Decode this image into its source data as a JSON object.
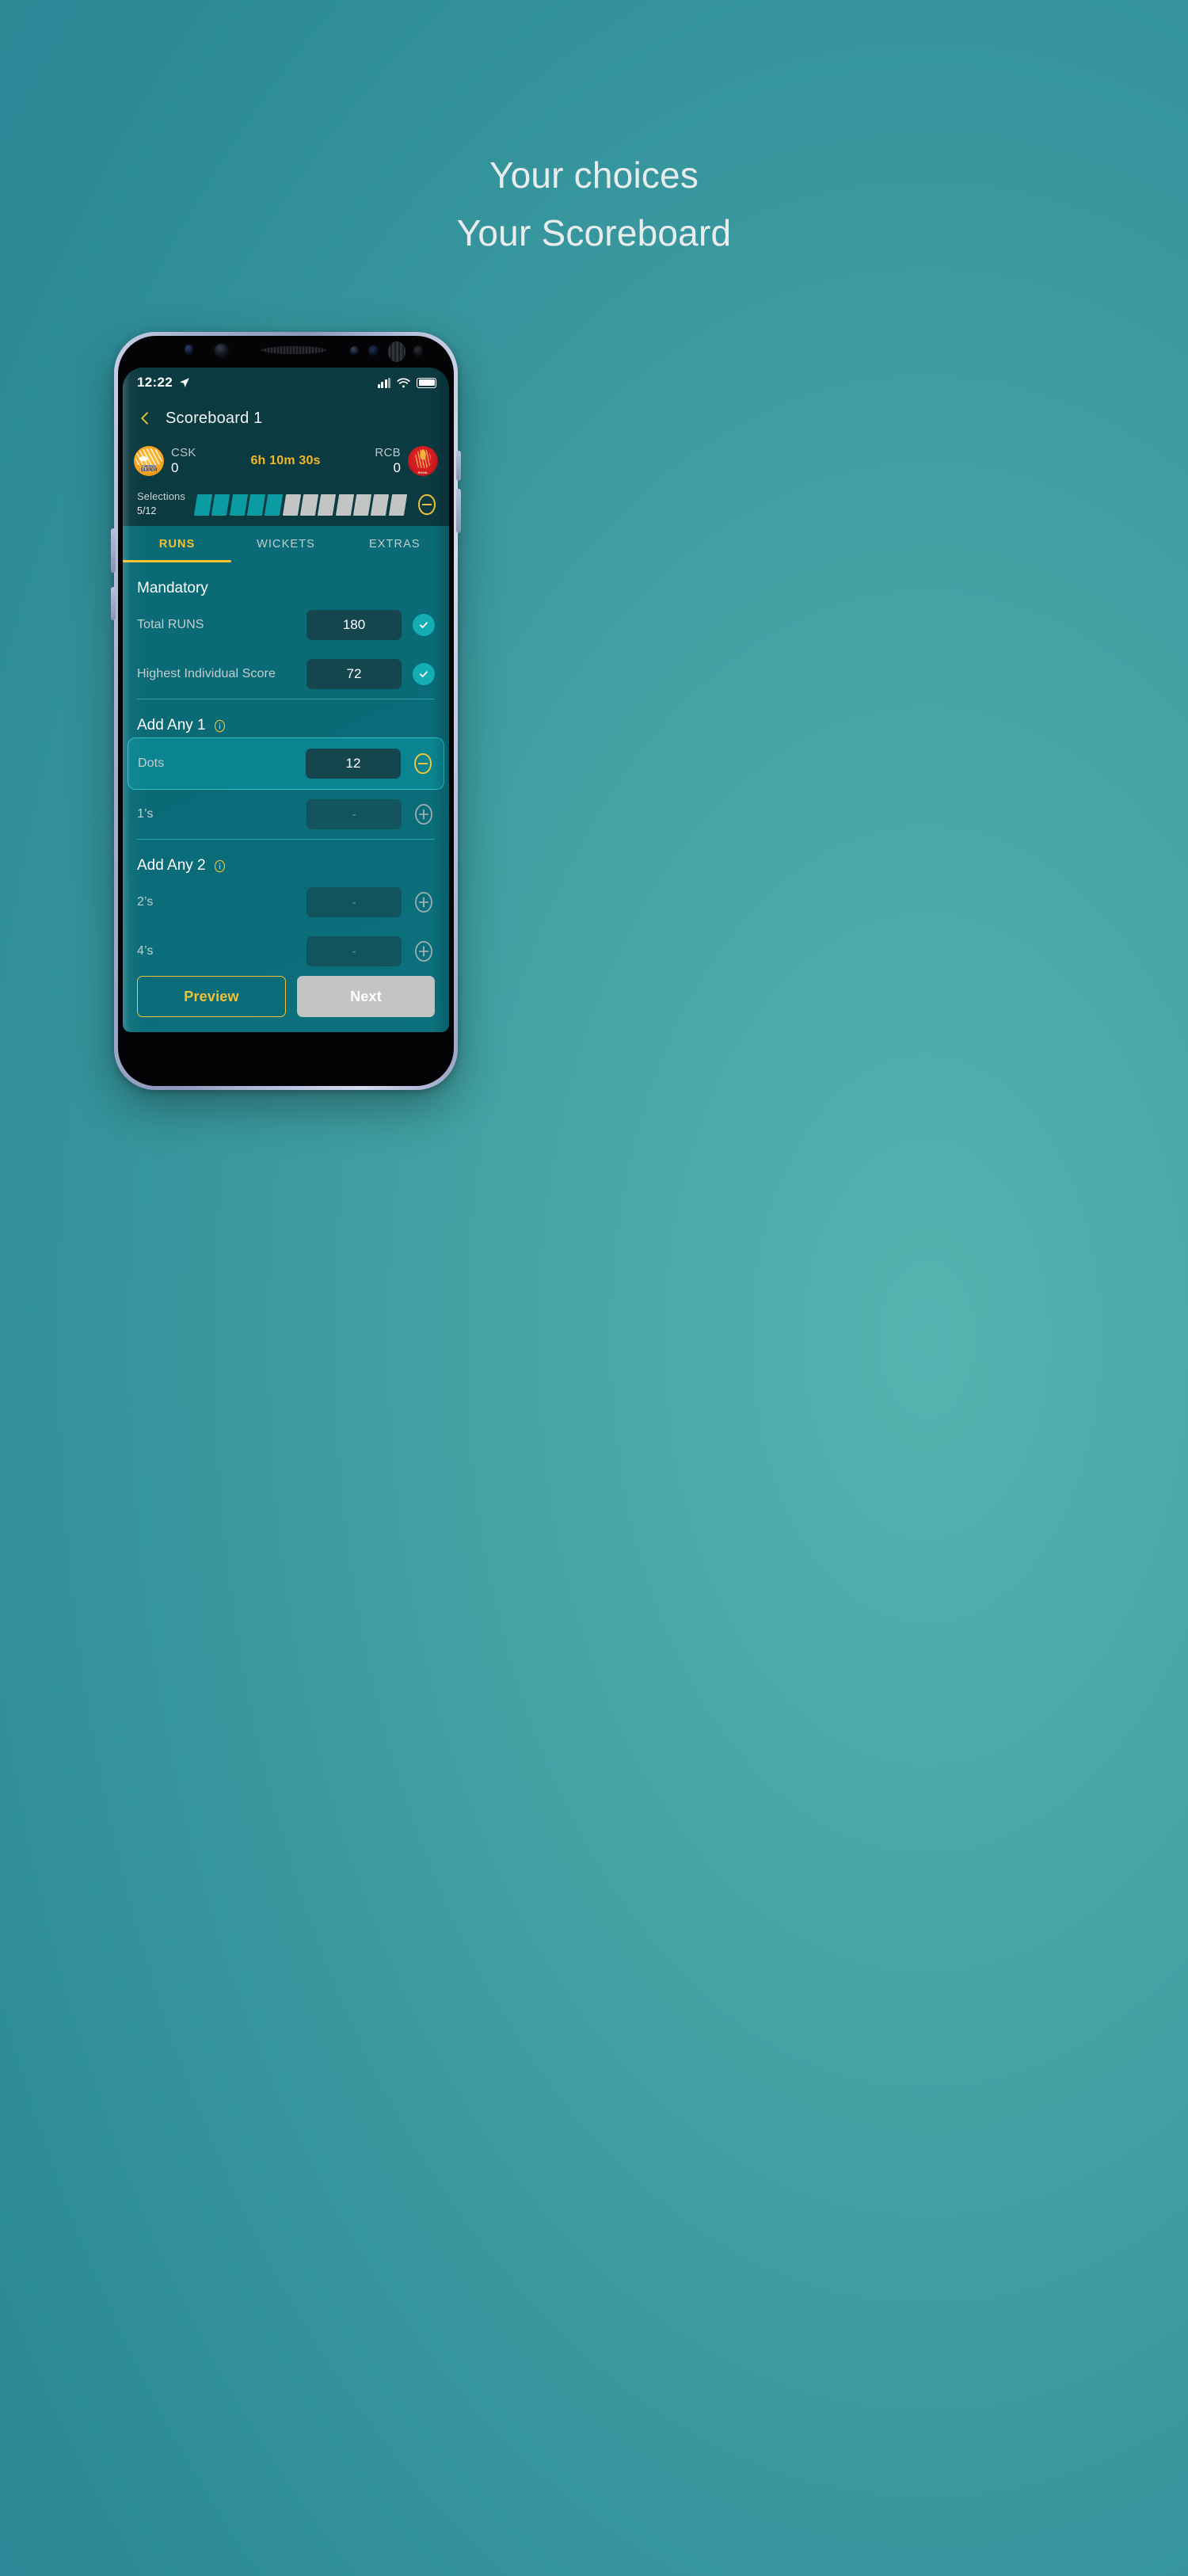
{
  "promo": {
    "line1": "Your choices",
    "line2": "Your Scoreboard"
  },
  "status_bar": {
    "time": "12:22",
    "location_icon": "location-arrow-icon",
    "signal_icon": "signal-bars-icon",
    "wifi_icon": "wifi-icon",
    "battery_icon": "battery-full-icon"
  },
  "header": {
    "back_icon": "chevron-left-icon",
    "title": "Scoreboard 1"
  },
  "match": {
    "home": {
      "code": "CSK",
      "score": "0",
      "logo_name": "csk-logo",
      "logo_line1": "CHENNAI",
      "logo_line2": "SUPER",
      "logo_line3": "KINGS"
    },
    "away": {
      "code": "RCB",
      "score": "0",
      "logo_name": "rcb-logo",
      "logo_line1": "ROYAL",
      "logo_line2": "CHALLENGERS"
    },
    "timer": "6h 10m 30s"
  },
  "selections": {
    "label": "Selections",
    "count": "5",
    "total": "/12",
    "filled": 5,
    "segments": 12,
    "action_icon": "minus-circle-icon",
    "filled_color": "#0b9ba3",
    "empty_color": "#c3c4c4"
  },
  "tabs": [
    {
      "label": "RUNS",
      "active": true
    },
    {
      "label": "WICKETS",
      "active": false
    },
    {
      "label": "EXTRAS",
      "active": false
    }
  ],
  "sections": [
    {
      "title": "Mandatory",
      "has_info": false,
      "rows": [
        {
          "label": "Total RUNS",
          "value": "180",
          "state": "filled",
          "control": "check-circle-icon"
        },
        {
          "label": "Highest Individual Score",
          "value": "72",
          "state": "filled",
          "control": "check-circle-icon"
        }
      ]
    },
    {
      "title": "Add Any 1",
      "has_info": true,
      "info_icon": "info-circle-icon",
      "rows": [
        {
          "label": "Dots",
          "value": "12",
          "state": "selected",
          "control": "minus-circle-icon"
        },
        {
          "label": "1’s",
          "value": "-",
          "state": "empty",
          "control": "plus-circle-icon"
        }
      ]
    },
    {
      "title": "Add Any 2",
      "has_info": true,
      "info_icon": "info-circle-icon",
      "rows": [
        {
          "label": "2’s",
          "value": "-",
          "state": "empty",
          "control": "plus-circle-icon"
        },
        {
          "label": "4’s",
          "value": "-",
          "state": "empty",
          "control": "plus-circle-icon"
        }
      ]
    }
  ],
  "footer": {
    "preview_label": "Preview",
    "next_label": "Next"
  },
  "colors": {
    "accent_yellow": "#f0c23a",
    "teal_dark": "#0c3a41",
    "teal_mid": "#0a6b77",
    "teal_bright": "#13aeb4",
    "page_bg": "#3a9ba1"
  }
}
